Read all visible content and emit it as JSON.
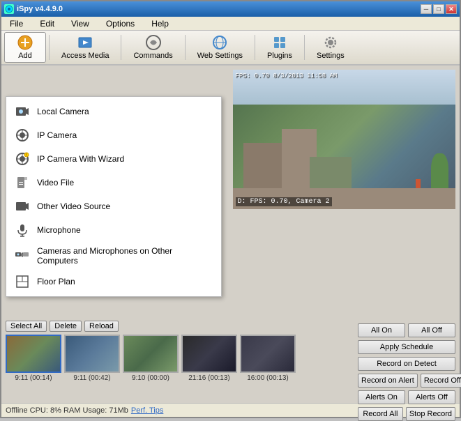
{
  "window": {
    "title": "iSpy v4.4.9.0",
    "min_label": "─",
    "max_label": "□",
    "close_label": "✕"
  },
  "menu": {
    "items": [
      "File",
      "Edit",
      "View",
      "Options",
      "Help"
    ]
  },
  "toolbar": {
    "buttons": [
      {
        "id": "add",
        "label": "Add"
      },
      {
        "id": "access-media",
        "label": "Access Media"
      },
      {
        "id": "commands",
        "label": "Commands"
      },
      {
        "id": "web-settings",
        "label": "Web Settings"
      },
      {
        "id": "plugins",
        "label": "Plugins"
      },
      {
        "id": "settings",
        "label": "Settings"
      }
    ]
  },
  "dropdown": {
    "items": [
      {
        "id": "local-camera",
        "label": "Local Camera"
      },
      {
        "id": "ip-camera",
        "label": "IP Camera"
      },
      {
        "id": "ip-camera-wizard",
        "label": "IP Camera With Wizard"
      },
      {
        "id": "video-file",
        "label": "Video File"
      },
      {
        "id": "other-video",
        "label": "Other Video Source"
      },
      {
        "id": "microphone",
        "label": "Microphone"
      },
      {
        "id": "cameras-other",
        "label": "Cameras and Microphones on Other Computers"
      },
      {
        "id": "floor-plan",
        "label": "Floor Plan"
      }
    ]
  },
  "video": {
    "overlay_text": "FPS: 0.70 8/3/2013 11:58 AM",
    "label": "D: FPS: 0.70, Camera 2"
  },
  "camera_bar": {
    "controls": [
      "Select All",
      "Delete",
      "Reload"
    ],
    "thumbs": [
      {
        "label": "9:11 (00:14)"
      },
      {
        "label": "9:11 (00:42)"
      },
      {
        "label": "9:10 (00:00)"
      },
      {
        "label": "21:16 (00:13)"
      },
      {
        "label": "16:00 (00:13)"
      }
    ]
  },
  "side_buttons": {
    "rows": [
      [
        {
          "label": "All On",
          "id": "all-on"
        },
        {
          "label": "All Off",
          "id": "all-off"
        }
      ],
      [
        {
          "label": "Apply Schedule",
          "id": "apply-schedule"
        }
      ],
      [
        {
          "label": "Record on Detect",
          "id": "record-on-detect"
        }
      ],
      [
        {
          "label": "Record on Alert",
          "id": "record-on-alert"
        },
        {
          "label": "Record Off",
          "id": "record-off"
        }
      ],
      [
        {
          "label": "Alerts On",
          "id": "alerts-on"
        },
        {
          "label": "Alerts Off",
          "id": "alerts-off"
        }
      ],
      [
        {
          "label": "Record All",
          "id": "record-all"
        },
        {
          "label": "Stop Record",
          "id": "stop-record"
        }
      ]
    ]
  },
  "status_bar": {
    "text": "Offline  CPU: 8% RAM Usage: 71Mb",
    "link": "Perf. Tips",
    "dots": "..."
  }
}
